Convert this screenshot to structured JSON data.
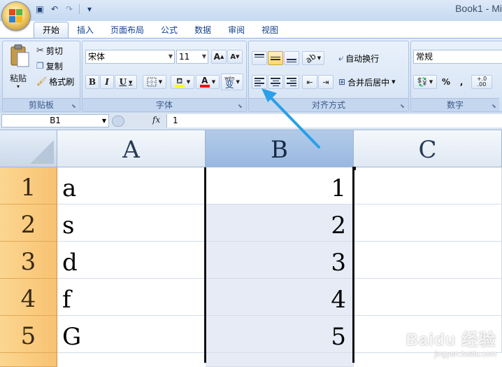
{
  "window": {
    "title": "Book1 - Mi"
  },
  "quick_access": [
    {
      "name": "save-icon",
      "glyph": "▣"
    },
    {
      "name": "undo-icon",
      "glyph": "↶"
    },
    {
      "name": "redo-icon",
      "glyph": "↷"
    },
    {
      "name": "customize-qat-icon",
      "glyph": "▾"
    }
  ],
  "tabs": [
    "开始",
    "插入",
    "页面布局",
    "公式",
    "数据",
    "审阅",
    "视图"
  ],
  "active_tab": "开始",
  "clipboard": {
    "paste_label": "粘贴",
    "cut_label": "剪切",
    "copy_label": "复制",
    "format_painter_label": "格式刷",
    "group_title": "剪贴板"
  },
  "font": {
    "font_name": "宋体",
    "font_size": "11",
    "grow_label": "A",
    "shrink_label": "A",
    "bold": "B",
    "italic": "I",
    "underline": "U",
    "font_color_letter": "A",
    "phonetic_label": "wén",
    "phonetic_char": "变",
    "group_title": "字体"
  },
  "alignment": {
    "wrap_label": "自动换行",
    "merge_label": "合并后居中",
    "group_title": "对齐方式"
  },
  "number": {
    "format": "常规",
    "percent": "%",
    "comma": ",",
    "inc_decimal": "+.0 .00",
    "group_title": "数字"
  },
  "formula_bar": {
    "name_box": "B1",
    "fx_label": "fx",
    "formula_value": "1"
  },
  "sheet": {
    "columns": [
      "A",
      "B",
      "C"
    ],
    "selected_column": "B",
    "rows": [
      {
        "row": "1",
        "A": "a",
        "B": "1",
        "C": ""
      },
      {
        "row": "2",
        "A": "s",
        "B": "2",
        "C": ""
      },
      {
        "row": "3",
        "A": "d",
        "B": "3",
        "C": ""
      },
      {
        "row": "4",
        "A": "f",
        "B": "4",
        "C": ""
      },
      {
        "row": "5",
        "A": "G",
        "B": "5",
        "C": ""
      }
    ]
  },
  "watermark": {
    "brand": "Baidu 经验",
    "url": "jingyan.baidu.com"
  },
  "colors": {
    "ribbon": "#dbe7f6",
    "accent": "#15428b",
    "row_header": "#f8c272",
    "selected_column": "#99b8e0",
    "arrow": "#2aa0e8",
    "font_highlight": "#ffff00",
    "font_color": "#ff0000"
  }
}
